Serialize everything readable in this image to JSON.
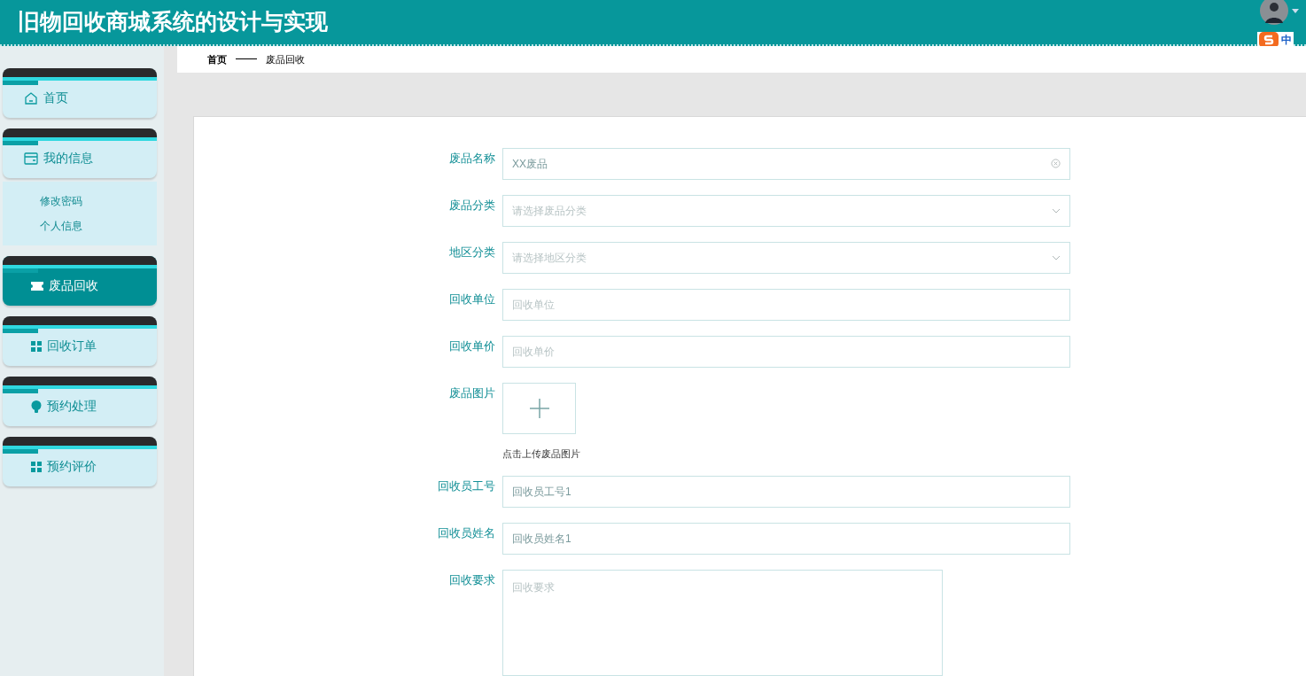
{
  "header": {
    "title": "旧物回收商城系统的设计与实现",
    "ime_label": "中"
  },
  "sidebar": {
    "items": [
      {
        "label": "首页",
        "kind": "home",
        "selected": false
      },
      {
        "label": "我的信息",
        "kind": "card",
        "selected": false,
        "children": [
          {
            "label": "修改密码"
          },
          {
            "label": "个人信息"
          }
        ]
      },
      {
        "label": "废品回收",
        "kind": "ticket",
        "selected": true
      },
      {
        "label": "回收订单",
        "kind": "grid",
        "selected": false
      },
      {
        "label": "预约处理",
        "kind": "bulb",
        "selected": false
      },
      {
        "label": "预约评价",
        "kind": "grid",
        "selected": false
      }
    ]
  },
  "breadcrumb": {
    "items": [
      "首页",
      "废品回收"
    ]
  },
  "form": {
    "fields": [
      {
        "kind": "text",
        "label": "废品名称",
        "value": "XX废品",
        "clearable": true
      },
      {
        "kind": "select",
        "label": "废品分类",
        "placeholder": "请选择废品分类"
      },
      {
        "kind": "select",
        "label": "地区分类",
        "placeholder": "请选择地区分类"
      },
      {
        "kind": "text",
        "label": "回收单位",
        "placeholder": "回收单位"
      },
      {
        "kind": "text",
        "label": "回收单价",
        "placeholder": "回收单价"
      },
      {
        "kind": "upload",
        "label": "废品图片",
        "hint": "点击上传废品图片"
      },
      {
        "kind": "text",
        "label": "回收员工号",
        "value": "回收员工号1"
      },
      {
        "kind": "text",
        "label": "回收员姓名",
        "value": "回收员姓名1"
      },
      {
        "kind": "textarea",
        "label": "回收要求",
        "placeholder": "回收要求"
      }
    ]
  }
}
